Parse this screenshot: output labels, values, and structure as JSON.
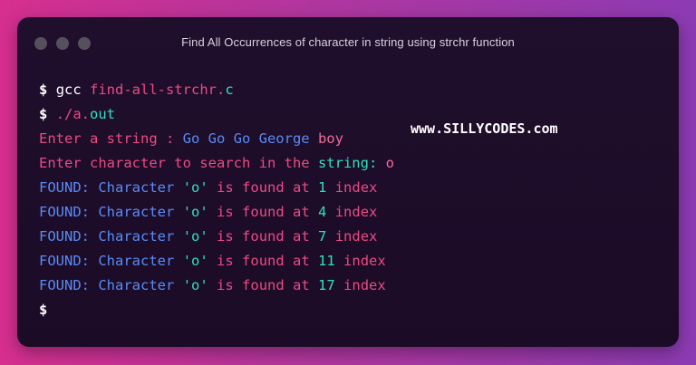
{
  "window": {
    "title": "Find All Occurrences of character in string using strchr function"
  },
  "watermark": "www.SILLYCODES.com",
  "terminal": {
    "prompt": "$",
    "line1": {
      "a": "gcc ",
      "b": "find-all-strchr.",
      "c": "c"
    },
    "line2": {
      "a": "./a.",
      "b": "out"
    },
    "line3": {
      "a": "Enter a string : ",
      "b": "Go Go Go George ",
      "c": "boy"
    },
    "line4": {
      "a": "Enter character to search in the ",
      "b": "string:",
      "c": " o"
    },
    "found_label": "FOUND:",
    "character_word": "Character",
    "char_literal": "'o'",
    "is_found_at": "is found at",
    "index_word": "index",
    "indices": [
      "1",
      "4",
      "7",
      "11",
      "17"
    ]
  },
  "colors": {
    "background_left": "#d62f8f",
    "background_right": "#8c3bb3",
    "window": "#1f0f2c",
    "red": "#ec4a83",
    "blue": "#5a8bf5",
    "teal": "#2fe0c2"
  }
}
